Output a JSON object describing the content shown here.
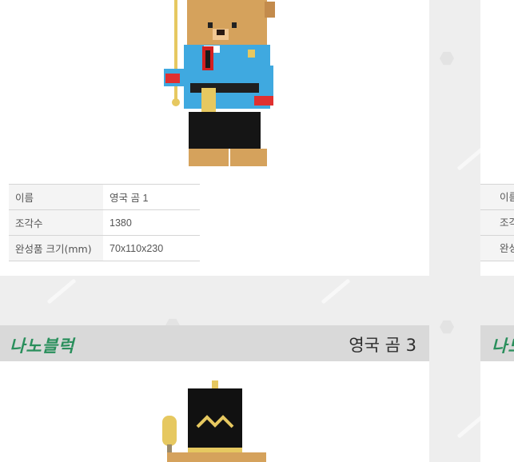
{
  "spec_rows": [
    {
      "label": "이름",
      "value": "영국 곰 1"
    },
    {
      "label": "조각수",
      "value": "1380"
    },
    {
      "label": "완성품 크기(mm)",
      "value": "70x110x230"
    }
  ],
  "right_card_labels": [
    "이름",
    "조각",
    "완성"
  ],
  "section_bar": {
    "brand": "나노블럭",
    "product_title": "영국 곰 3",
    "right_brand": "나노"
  },
  "colors": {
    "brand_green": "#2a8f5c",
    "bar_gray": "#d9d9d9",
    "bear_coat": "#3fa9e0"
  }
}
